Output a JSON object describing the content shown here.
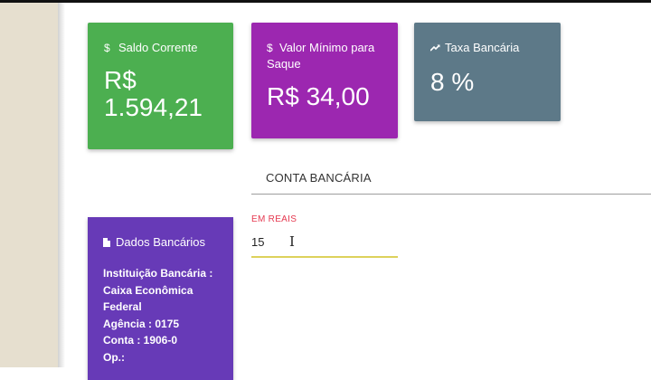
{
  "cards": {
    "saldo": {
      "title": "Saldo Corrente",
      "icon": "dollar-icon",
      "value_line1": "R$",
      "value_line2": "1.594,21",
      "color": "#4caf50"
    },
    "saque": {
      "title": "Valor Mínimo para Saque",
      "icon": "dollar-icon",
      "value": "R$ 34,00",
      "color": "#9c27b0"
    },
    "taxa": {
      "title": "Taxa Bancária",
      "icon": "trending-up-icon",
      "value": "8 %",
      "color": "#5d7988"
    }
  },
  "form": {
    "section_label": "CONTA BANCÁRIA",
    "field_label": "EM REAIS",
    "field_value": "15"
  },
  "dados": {
    "title": "Dados Bancários",
    "icon": "document-icon",
    "color": "#673ab7",
    "lines": [
      "Instituição Bancária :",
      "Caixa Econômica",
      "Federal",
      "Agência : 0175",
      "Conta : 1906-0",
      "Op.:"
    ]
  }
}
